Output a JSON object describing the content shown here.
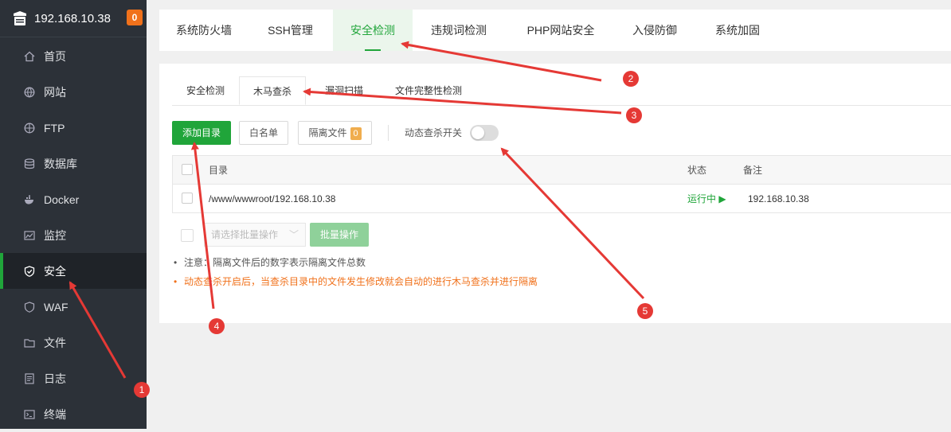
{
  "sidebar": {
    "host": "192.168.10.38",
    "badge": "0",
    "items": [
      {
        "label": "首页",
        "icon": "home-icon"
      },
      {
        "label": "网站",
        "icon": "globe-icon"
      },
      {
        "label": "FTP",
        "icon": "ftp-icon"
      },
      {
        "label": "数据库",
        "icon": "database-icon"
      },
      {
        "label": "Docker",
        "icon": "docker-icon"
      },
      {
        "label": "监控",
        "icon": "monitor-icon"
      },
      {
        "label": "安全",
        "icon": "shield-icon"
      },
      {
        "label": "WAF",
        "icon": "waf-icon"
      },
      {
        "label": "文件",
        "icon": "folder-icon"
      },
      {
        "label": "日志",
        "icon": "log-icon"
      },
      {
        "label": "终端",
        "icon": "terminal-icon"
      }
    ]
  },
  "top_tabs": [
    "系统防火墙",
    "SSH管理",
    "安全检测",
    "违规词检测",
    "PHP网站安全",
    "入侵防御",
    "系统加固"
  ],
  "sub_tabs": [
    "安全检测",
    "木马查杀",
    "漏洞扫描",
    "文件完整性检测"
  ],
  "toolbar": {
    "add_dir": "添加目录",
    "whitelist": "白名单",
    "quarantine": "隔离文件",
    "quarantine_count": "0",
    "toggle_label": "动态查杀开关"
  },
  "table": {
    "headers": {
      "dir": "目录",
      "status": "状态",
      "remark": "备注"
    },
    "rows": [
      {
        "dir": "/www/wwwroot/192.168.10.38",
        "status": "运行中 ▶",
        "remark": "192.168.10.38"
      }
    ]
  },
  "batch": {
    "placeholder": "请选择批量操作",
    "button": "批量操作"
  },
  "notes": [
    "注意：隔离文件后的数字表示隔离文件总数",
    "动态查杀开启后，当查杀目录中的文件发生修改就会自动的进行木马查杀并进行隔离"
  ],
  "markers": [
    "1",
    "2",
    "3",
    "4",
    "5"
  ],
  "colors": {
    "accent": "#20a53a",
    "annotation": "#e53935",
    "warning": "#f0711b"
  }
}
